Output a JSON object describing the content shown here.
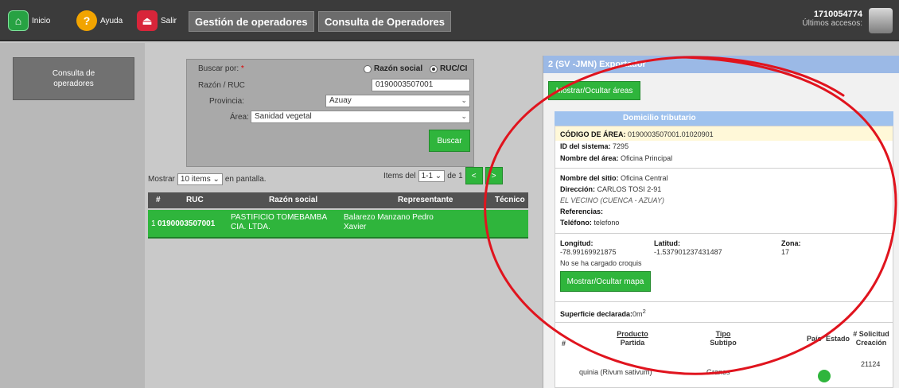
{
  "topbar": {
    "inicio": "Inicio",
    "ayuda": "Ayuda",
    "salir": "Salir",
    "tab_gestion": "Gestión de operadores",
    "tab_consulta": "Consulta de Operadores",
    "user_id": "1710054774",
    "last_access": "Últimos accesos:"
  },
  "sidebar": {
    "item": "Consulta de operadores"
  },
  "search": {
    "buscar_por": "Buscar por:",
    "req_mark": "*",
    "opt_razon": "Razón social",
    "opt_ruc": "RUC/CI",
    "label_ruc": "Razón / RUC",
    "ruc_value": "0190003507001",
    "label_provincia": "Provincia:",
    "provincia_value": "Azuay",
    "label_area": "Área:",
    "area_value": "Sanidad vegetal",
    "buscar_button": "Buscar"
  },
  "listing": {
    "mostrar": "Mostrar",
    "items_sel": "10 items",
    "en_pantalla": "en pantalla.",
    "items_del": "Items del",
    "range": "1-1",
    "de": "de 1",
    "prev": "<",
    "next": ">"
  },
  "table": {
    "headers": [
      "#",
      "RUC",
      "Razón social",
      "Representante",
      "Técnico"
    ],
    "row": {
      "num": "1",
      "ruc": "0190003507001",
      "razon": "PASTIFICIO TOMEBAMBA CIA. LTDA.",
      "representante": "Balarezo Manzano Pedro Xavier"
    }
  },
  "detail": {
    "header": "2 (SV -JMN) Exportador",
    "toggle_areas": "Mostrar/Ocultar áreas",
    "section_title": "Domicilio tributario",
    "codigo_label": "CÓDIGO DE ÁREA:",
    "codigo_value": "0190003507001.01020901",
    "id_label": "ID del sistema:",
    "id_value": "7295",
    "nombre_area_label": "Nombre del área:",
    "nombre_area_value": "Oficina Principal",
    "nombre_sitio_label": "Nombre del sitio:",
    "nombre_sitio_value": "Oficina Central",
    "direccion_label": "Dirección:",
    "direccion_value": "CARLOS TOSI 2-91",
    "ubicacion": "EL VECINO (CUENCA - AZUAY)",
    "referencias_label": "Referencias:",
    "telefono_label": "Teléfono:",
    "telefono_value": "telefono",
    "longitud_label": "Longitud:",
    "longitud_value": "-78.99169921875",
    "latitud_label": "Latitud:",
    "latitud_value": "-1.537901237431487",
    "zona_label": "Zona:",
    "zona_value": "17",
    "croquis": "No se ha cargado croquis",
    "toggle_mapa": "Mostrar/Ocultar mapa",
    "superficie_label": "Superficie declarada:",
    "superficie_value": "0m",
    "superficie_sup": "2",
    "cols": {
      "num": "#",
      "producto_1": "Producto",
      "producto_2": "Partida",
      "tipo_1": "Tipo",
      "tipo_2": "Subtipo",
      "pais": "País",
      "estado": "Estado",
      "solicitud_1": "# Solicitud",
      "solicitud_2": "Creación"
    },
    "row_producto": "quinia (Rivum sativum)",
    "row_tipo": "Granos",
    "row_solicitud": "21124"
  },
  "colors": {
    "accent_green": "#2fb53c",
    "header_blue": "#9bb9e6",
    "annotation_red": "#e0141e",
    "topbar": "#3b3b3b"
  }
}
